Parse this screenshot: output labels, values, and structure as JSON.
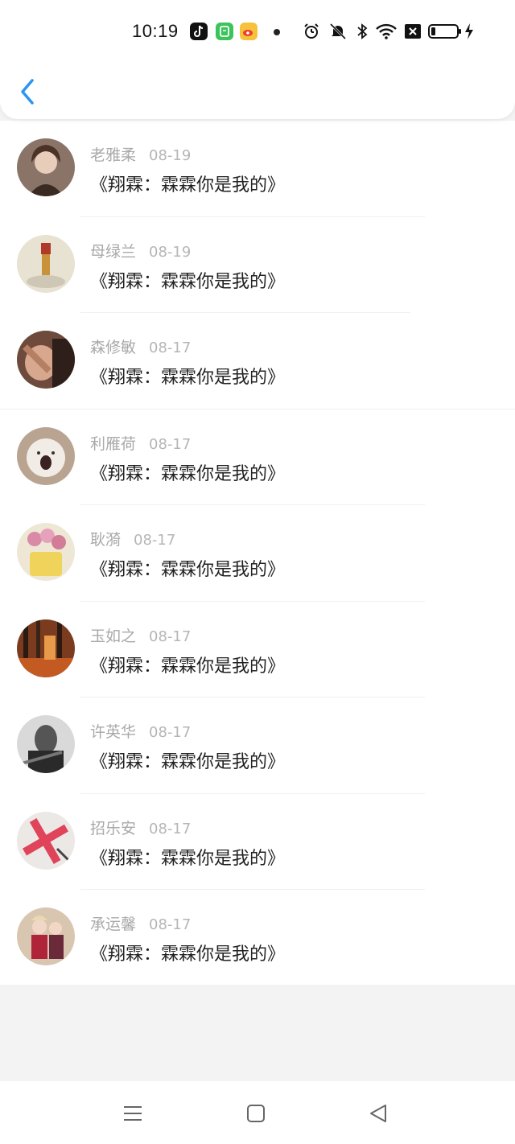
{
  "status_bar": {
    "time": "10:19",
    "app_icons": [
      "tiktok-icon",
      "green-app-icon",
      "weibo-icon"
    ],
    "system_icons": [
      "alarm-icon",
      "mute-icon",
      "bluetooth-icon",
      "wifi-icon",
      "sim-off-icon",
      "battery-icon",
      "charging-icon"
    ]
  },
  "header": {
    "back_icon": "chevron-left-icon",
    "accent_color": "#2b95f0"
  },
  "list": {
    "items": [
      {
        "name": "老雅柔",
        "date": "08-19",
        "message": "《翔霖：霖霖你是我的》",
        "avatar_color": "#8a7468"
      },
      {
        "name": "母绿兰",
        "date": "08-19",
        "message": "《翔霖：霖霖你是我的》",
        "avatar_color": "#d6c9a8"
      },
      {
        "name": "森修敏",
        "date": "08-17",
        "message": "《翔霖：霖霖你是我的》",
        "avatar_color": "#6d4a3c"
      },
      {
        "name": "利雁荷",
        "date": "08-17",
        "message": "《翔霖：霖霖你是我的》",
        "avatar_color": "#c9b6a3"
      },
      {
        "name": "耿漪",
        "date": "08-17",
        "message": "《翔霖：霖霖你是我的》",
        "avatar_color": "#e3c98a"
      },
      {
        "name": "玉如之",
        "date": "08-17",
        "message": "《翔霖：霖霖你是我的》",
        "avatar_color": "#8a4a25"
      },
      {
        "name": "许英华",
        "date": "08-17",
        "message": "《翔霖：霖霖你是我的》",
        "avatar_color": "#3b3b3b"
      },
      {
        "name": "招乐安",
        "date": "08-17",
        "message": "《翔霖：霖霖你是我的》",
        "avatar_color": "#e0b7bf"
      },
      {
        "name": "承运馨",
        "date": "08-17",
        "message": "《翔霖：霖霖你是我的》",
        "avatar_color": "#b3906e"
      }
    ]
  },
  "navbar": {
    "icons": [
      "menu-icon",
      "home-icon",
      "back-triangle-icon"
    ]
  }
}
